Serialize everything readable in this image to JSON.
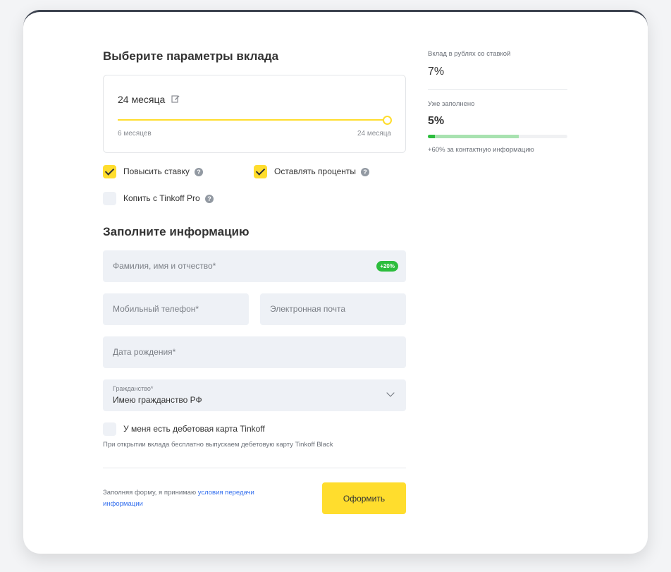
{
  "form": {
    "params_title": "Выберите параметры вклада",
    "slider": {
      "value_label": "24 месяца",
      "min_label": "6 месяцев",
      "max_label": "24 месяца",
      "fraction": 1.0
    },
    "options": {
      "raise_rate": {
        "label": "Повысить ставку",
        "checked": true
      },
      "keep_interest": {
        "label": "Оставлять проценты",
        "checked": true
      },
      "save_pro": {
        "label": "Копить с Tinkoff Pro",
        "checked": false
      }
    },
    "info_title": "Заполните информацию",
    "fields": {
      "fullname": {
        "placeholder": "Фамилия, имя и отчество*",
        "badge": "+20%"
      },
      "phone": {
        "placeholder": "Мобильный телефон*"
      },
      "email": {
        "placeholder": "Электронная почта"
      },
      "birthdate": {
        "placeholder": "Дата рождения*"
      },
      "citizenship": {
        "label": "Гражданство*",
        "value": "Имею гражданство РФ"
      }
    },
    "debit_card": {
      "label": "У меня есть дебетовая карта Tinkoff",
      "checked": false,
      "note": "При открытии вклада бесплатно выпускаем дебетовую карту Tinkoff Black"
    },
    "consent": {
      "text": "Заполняя форму, я принимаю ",
      "link": "условия передачи информации"
    },
    "submit_label": "Оформить"
  },
  "summary": {
    "rate_label": "Вклад в рублях со ставкой",
    "rate_value": "7%",
    "filled_label": "Уже заполнено",
    "filled_value": "5%",
    "filled_fraction": 0.05,
    "potential_fraction": 0.6,
    "hint": "+60% за контактную информацию"
  },
  "colors": {
    "accent": "#ffdd2d",
    "success": "#2cbd3d",
    "link": "#336fee",
    "field_bg": "#eef1f6"
  }
}
